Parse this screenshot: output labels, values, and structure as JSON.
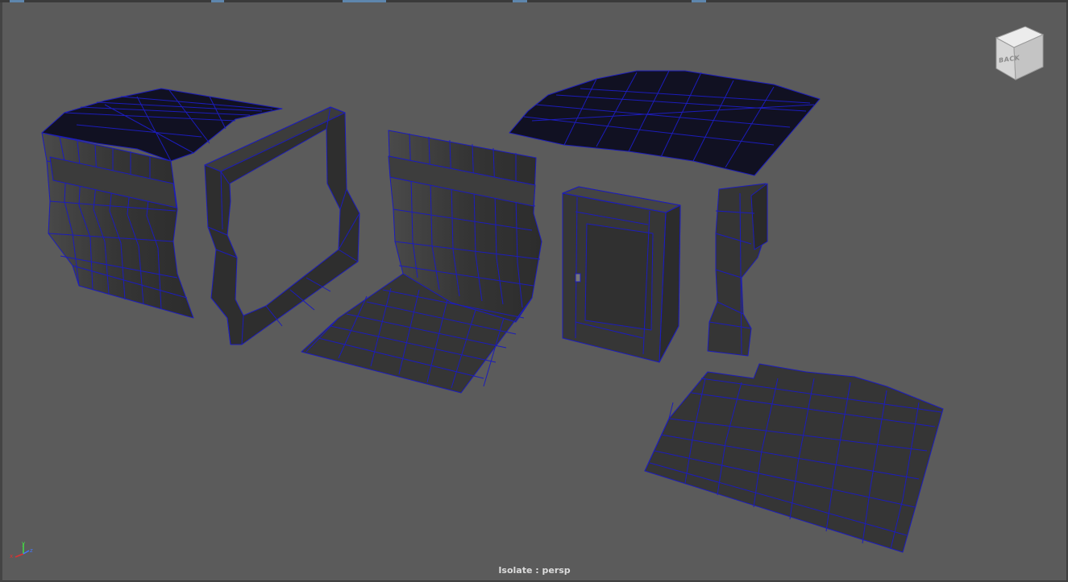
{
  "viewport": {
    "status_text": "Isolate : persp",
    "camera": "persp",
    "background_color": "#5b5b5b",
    "wireframe_color": "#1c1cbb"
  },
  "viewcube": {
    "face_label": "BACK",
    "icon": "view-cube-icon"
  },
  "axis_gizmo": {
    "x_label": "x",
    "y_label": "y",
    "z_label": "z",
    "x_color": "#dd3333",
    "y_color": "#44dd44",
    "z_color": "#4477ff"
  },
  "scene_objects": [
    "wall-panel-slatted",
    "arch-frame",
    "curved-wall-floor",
    "door-frame",
    "pillar",
    "roof-slab",
    "ground-terrain"
  ]
}
